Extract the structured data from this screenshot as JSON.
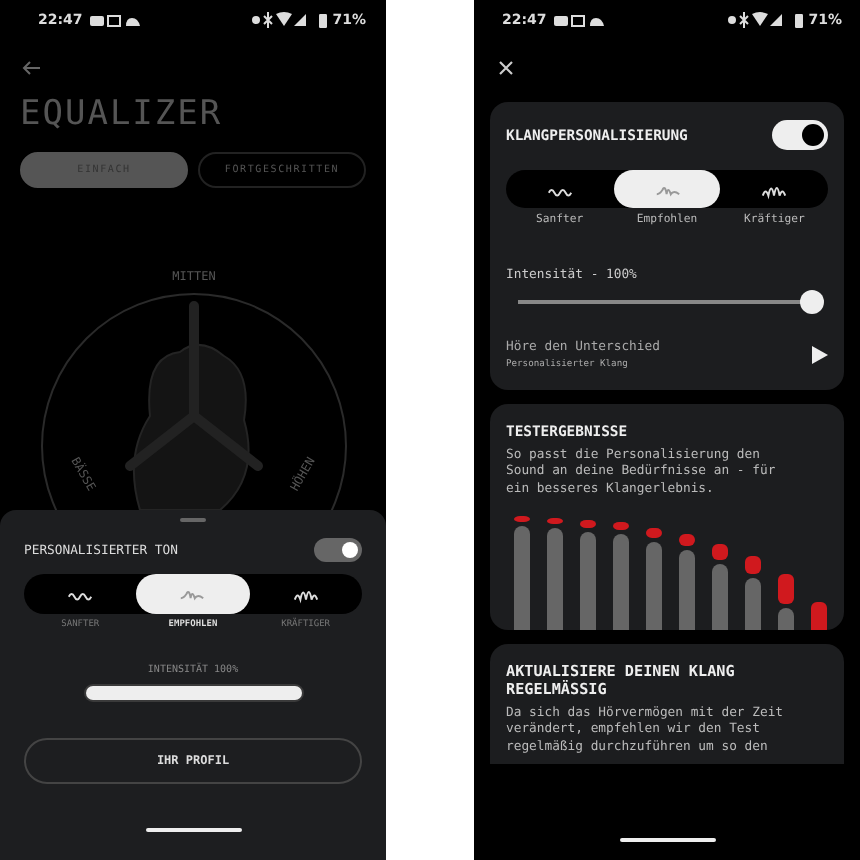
{
  "left_screen": {
    "status_bar": {
      "time": "22:47",
      "battery": "71%"
    },
    "title": "EQUALIZER",
    "tabs": [
      {
        "label": "EINFACH",
        "selected": true
      },
      {
        "label": "FORTGESCHRITTEN",
        "selected": false
      }
    ],
    "dial": {
      "labels": [
        "MITTEN",
        "BÄSSE",
        "HÖHEN"
      ]
    },
    "sheet": {
      "title": "PERSONALISIERTER TON",
      "toggle_on": true,
      "presets": [
        {
          "label": "SANFTER",
          "selected": false
        },
        {
          "label": "EMPFOHLEN",
          "selected": true
        },
        {
          "label": "KRÄFTIGER",
          "selected": false
        }
      ],
      "intensity": {
        "label": "INTENSITÄT 100%",
        "level": 1
      },
      "button": "IHR PROFIL"
    }
  },
  "right_screen": {
    "status_bar": {
      "time": "22:47",
      "battery": "71%"
    },
    "personalization": {
      "title": "KLANGPERSONALISIERUNG",
      "toggle_on": true,
      "presets": [
        {
          "label": "Sanfter",
          "selected": false
        },
        {
          "label": "Empfohlen",
          "selected": true
        },
        {
          "label": "Kräftiger",
          "selected": false
        }
      ],
      "intensity": {
        "label": "Intensität - 100%",
        "level": 1
      },
      "listen": {
        "title": "Höre den Unterschied",
        "subtitle": "Personalisierter Klang"
      }
    },
    "results": {
      "title": "TESTERGEBNISSE",
      "text": "So passt die Personalisierung den Sound an deine Bedürfnisse an - für ein besseres Klangerlebnis."
    },
    "update": {
      "title": "AKTUALISIERE DEINEN KLANG REGELMÄSSIG",
      "text": "Da sich das Hörvermögen mit der Zeit verändert, empfehlen wir den Test regelmäßig durchzuführen um so den"
    }
  }
}
